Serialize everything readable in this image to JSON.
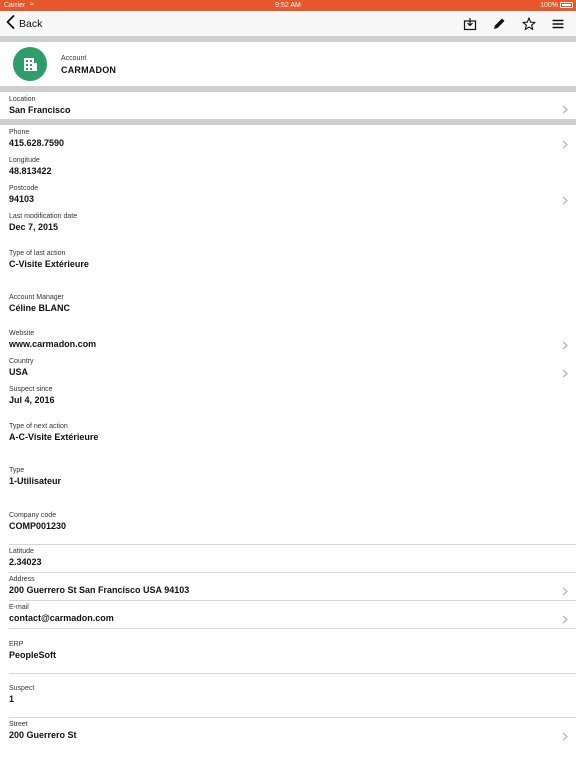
{
  "status_bar": {
    "carrier": "Carrier",
    "time": "9:52 AM",
    "battery": "100%"
  },
  "nav": {
    "back_label": "Back",
    "icons": [
      "download-icon",
      "edit-icon",
      "star-icon",
      "menu-icon"
    ]
  },
  "colors": {
    "status_bar": "#e8562b",
    "account_icon": "#2e9c6b"
  },
  "account": {
    "label": "Account",
    "name": "CARMADON",
    "icon": "building-icon"
  },
  "location": {
    "label": "Location",
    "value": "San Francisco"
  },
  "fields": [
    {
      "label": "Phone",
      "value": "415.628.7590",
      "chevron": true
    },
    {
      "label": "Longitude",
      "value": "48.813422",
      "chevron": false
    },
    {
      "label": "Postcode",
      "value": "94103",
      "chevron": true
    },
    {
      "label": "Last modification date",
      "value": "Dec 7, 2015",
      "chevron": false
    },
    {
      "label": "Type of last action",
      "value": "C-Visite Extérieure",
      "chevron": false
    },
    {
      "label": "Account Manager",
      "value": "Céline BLANC",
      "chevron": false
    },
    {
      "label": "Website",
      "value": "www.carmadon.com",
      "chevron": true
    },
    {
      "label": "Country",
      "value": "USA",
      "chevron": true
    },
    {
      "label": "Suspect since",
      "value": "Jul 4, 2016",
      "chevron": false
    },
    {
      "label": "Type of next action",
      "value": "A-C-Visite Extérieure",
      "chevron": false
    },
    {
      "label": "Type",
      "value": "1-Utilisateur",
      "chevron": false
    },
    {
      "label": "Company code",
      "value": "COMP001230",
      "chevron": false
    },
    {
      "label": "Latitude",
      "value": "2.34023",
      "chevron": false
    },
    {
      "label": "Address",
      "value": "200 Guerrero St San Francisco USA 94103",
      "chevron": true
    },
    {
      "label": "E-mail",
      "value": "contact@carmadon.com",
      "chevron": true
    },
    {
      "label": "ERP",
      "value": "PeopleSoft",
      "chevron": false
    },
    {
      "label": "Suspect",
      "value": "1",
      "chevron": false
    },
    {
      "label": "Street",
      "value": "200 Guerrero St",
      "chevron": true
    }
  ]
}
